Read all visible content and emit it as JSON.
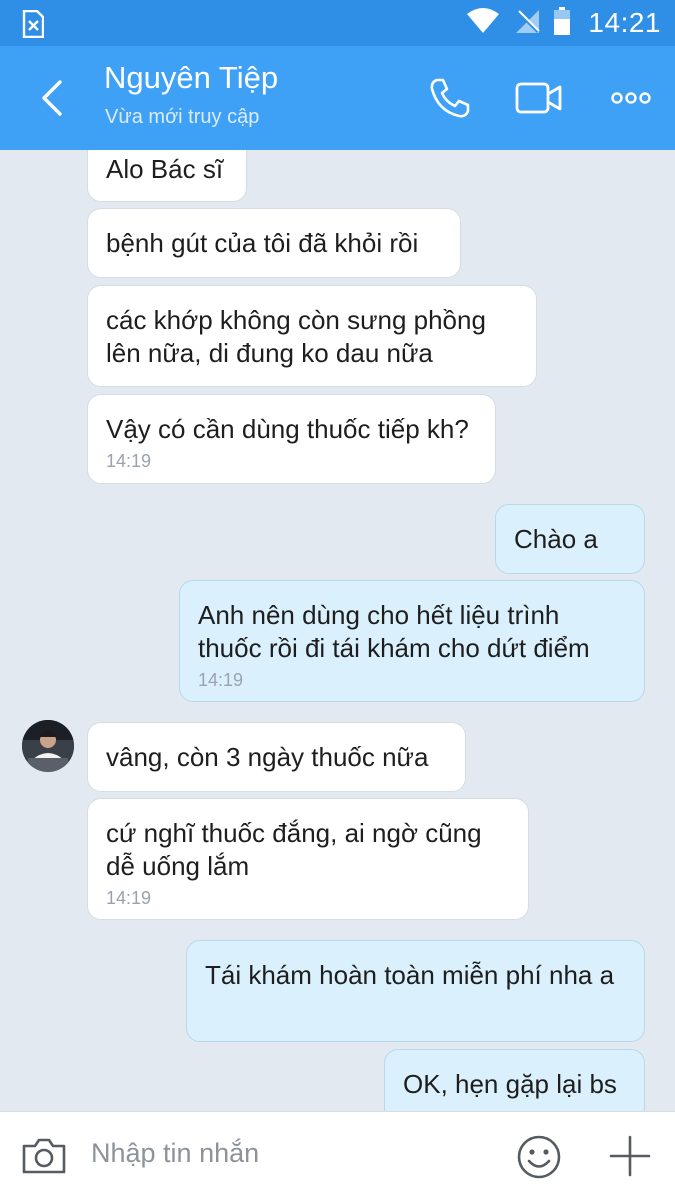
{
  "status_bar": {
    "time": "14:21",
    "icons": [
      "sim-error-icon",
      "wifi-icon",
      "no-signal-icon",
      "battery-icon"
    ]
  },
  "header": {
    "contact_name": "Nguyên Tiệp",
    "contact_status": "Vừa mới truy cập",
    "icons": [
      "back-arrow-icon",
      "phone-icon",
      "video-call-icon",
      "more-icon"
    ]
  },
  "messages": [
    {
      "side": "in",
      "text": "Alo Bác sĩ",
      "time": ""
    },
    {
      "side": "in",
      "text": "bệnh gút của tôi đã khỏi rồi",
      "time": ""
    },
    {
      "side": "in",
      "text": "các khớp không còn sưng phồng lên nữa, di đung ko dau nữa",
      "time": ""
    },
    {
      "side": "in",
      "text": "Vậy có cần dùng thuốc tiếp kh?",
      "time": "14:19"
    },
    {
      "side": "out",
      "text": "Chào a",
      "time": ""
    },
    {
      "side": "out",
      "text": "Anh nên dùng cho hết liệu trình thuốc rồi đi tái khám cho dứt điểm",
      "time": "14:19"
    },
    {
      "side": "in",
      "text": "vâng, còn 3 ngày thuốc nữa",
      "time": ""
    },
    {
      "side": "in",
      "text": "cứ nghĩ thuốc đắng, ai ngờ cũng dễ uống lắm",
      "time": "14:19"
    },
    {
      "side": "out",
      "text": "Tái khám hoàn toàn miễn phí nha a",
      "time": ""
    },
    {
      "side": "out",
      "text": "OK, hẹn gặp lại bs",
      "time": ""
    }
  ],
  "input_bar": {
    "placeholder": "Nhập tin nhắn",
    "icons": [
      "camera-icon",
      "emoji-icon",
      "plus-icon"
    ]
  },
  "colors": {
    "header": "#3ea1f6",
    "status_bar": "#2f8fe6",
    "chat_background": "#e3e9f0",
    "incoming_bubble": "#ffffff",
    "outgoing_bubble": "#daf1fd"
  }
}
